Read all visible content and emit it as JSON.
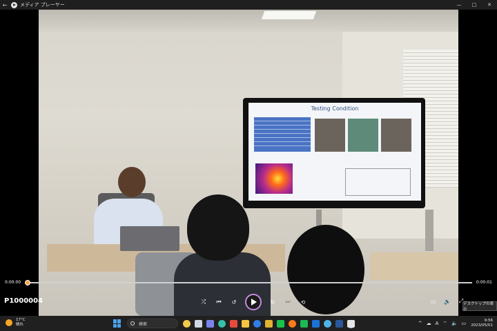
{
  "window": {
    "title": "メディア プレーヤー",
    "controls": {
      "minimize": "—",
      "maximize": "□",
      "close": "✕"
    },
    "back_icon": "back-arrow-icon"
  },
  "video": {
    "slide_title": "Testing Condition"
  },
  "player": {
    "current_time": "0:00:00",
    "end_time": "0:00:01",
    "progress": 0.0,
    "media_title": "P1000004",
    "controls": [
      {
        "name": "shuffle-icon",
        "glyph": "⤮"
      },
      {
        "name": "previous-icon",
        "glyph": "⏮"
      },
      {
        "name": "rewind-10-icon",
        "glyph": "↺"
      },
      {
        "name": "play-icon",
        "glyph": ""
      },
      {
        "name": "forward-30-icon",
        "glyph": "↻"
      },
      {
        "name": "next-icon",
        "glyph": "⏭"
      },
      {
        "name": "repeat-off-icon",
        "glyph": "⟲"
      }
    ],
    "right_controls": [
      {
        "name": "miniplayer-icon",
        "glyph": "▭"
      },
      {
        "name": "volume-icon",
        "glyph": "🔊"
      },
      {
        "name": "fullscreen-icon",
        "glyph": "⤢"
      },
      {
        "name": "more-icon",
        "glyph": "⋯"
      }
    ],
    "tooltip": "デスクトップの表示"
  },
  "taskbar": {
    "weather_temp": "17°C",
    "weather_desc": "晴れ",
    "search_placeholder": "検索",
    "apps": [
      {
        "name": "widgets-icon",
        "color": "#f2c94c"
      },
      {
        "name": "task-view-icon",
        "color": "#cfd8e3"
      },
      {
        "name": "chat-icon",
        "color": "#7b83eb"
      },
      {
        "name": "edge-icon",
        "color": "#35c1a6"
      },
      {
        "name": "chrome-icon",
        "color": "#e84a3d"
      },
      {
        "name": "file-explorer-icon",
        "color": "#f4c542"
      },
      {
        "name": "store-icon",
        "color": "#2f7ee9"
      },
      {
        "name": "google-chrome-icon",
        "color": "#e0b334"
      },
      {
        "name": "line-icon",
        "color": "#19c24b"
      },
      {
        "name": "firefox-icon",
        "color": "#ff7a1a"
      },
      {
        "name": "spotify-icon",
        "color": "#1db954"
      },
      {
        "name": "outlook-icon",
        "color": "#1a73d9"
      },
      {
        "name": "photos-icon",
        "color": "#4fb5e8"
      },
      {
        "name": "word-icon",
        "color": "#2b579a"
      },
      {
        "name": "media-player-icon",
        "color": "#e6e6e6"
      }
    ],
    "tray": {
      "chevron": "^",
      "cloud": "☁",
      "ime": "A",
      "wifi": "⌔",
      "speaker": "🔈",
      "battery": "▭",
      "time": "9:56",
      "date": "2023/05/01"
    }
  }
}
